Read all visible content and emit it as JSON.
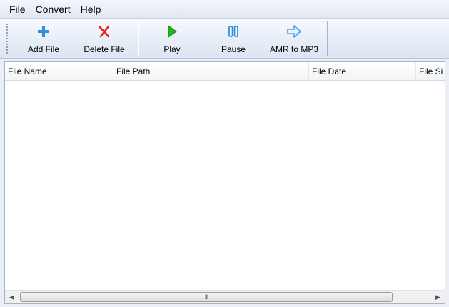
{
  "menu": {
    "file": "File",
    "convert": "Convert",
    "help": "Help"
  },
  "toolbar": {
    "add_file": "Add File",
    "delete_file": "Delete File",
    "play": "Play",
    "pause": "Pause",
    "amr_to_mp3": "AMR to MP3",
    "icons": {
      "add_file": "plus-icon",
      "delete_file": "x-icon",
      "play": "play-icon",
      "pause": "pause-icon",
      "amr_to_mp3": "arrow-right-icon"
    },
    "colors": {
      "add": "#2f8ee0",
      "delete": "#e2231a",
      "play": "#22b422",
      "pause": "#2f8ee0",
      "convert": "#4aa0e8"
    }
  },
  "list": {
    "columns": [
      "File Name",
      "File Path",
      "File Date",
      "File Si"
    ],
    "rows": []
  },
  "scrollbar": {
    "grip": "III"
  }
}
